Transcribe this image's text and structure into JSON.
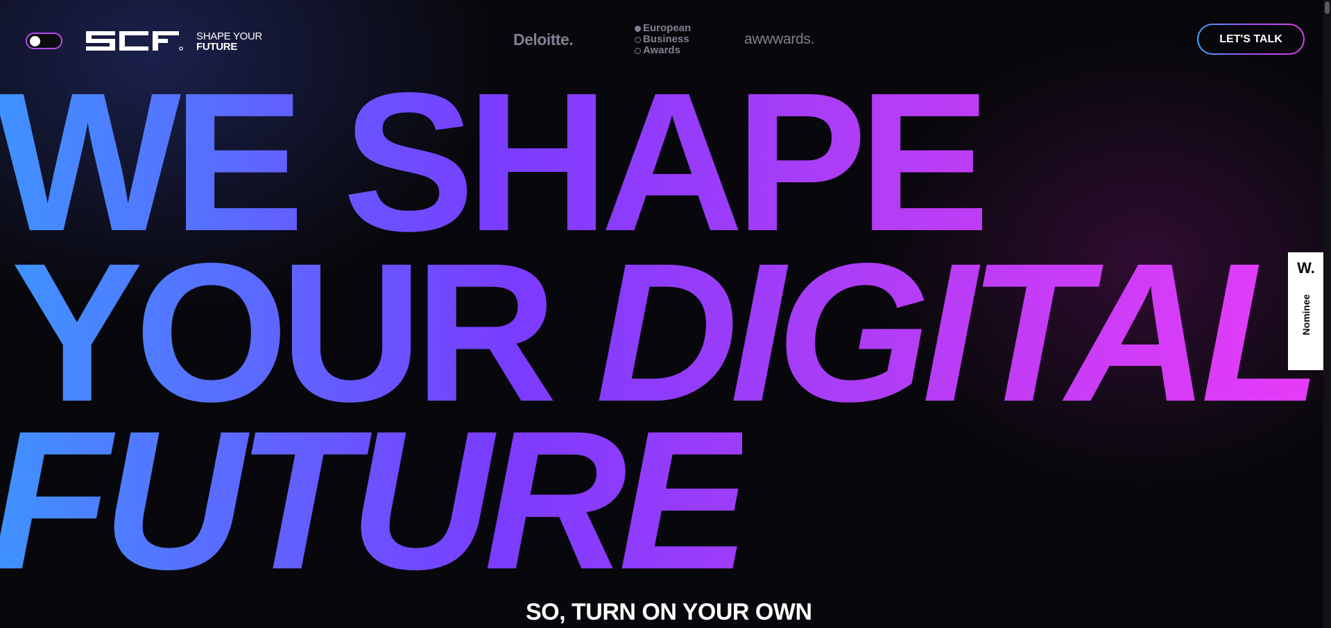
{
  "header": {
    "theme_toggle": "toggle",
    "logo": {
      "alt": "SCF"
    },
    "tagline": {
      "line1": "SHAPE YOUR",
      "line2": "FUTURE"
    },
    "partners": {
      "deloitte": "Deloitte.",
      "european_business_awards": [
        "European",
        "Business",
        "Awards"
      ],
      "awwwards": "awwwards."
    },
    "cta_label": "LET'S TALK"
  },
  "hero": {
    "line1": "WE SHAPE",
    "line2_plain": "YOUR ",
    "line2_italic": "DIGITAL",
    "line3": "FUTURE",
    "subheading": "SO, TURN ON YOUR OWN"
  },
  "badge": {
    "mark": "W.",
    "label": "Nominee"
  },
  "colors": {
    "gradient_start": "#3f93ff",
    "gradient_mid": "#7a3cff",
    "gradient_end": "#ea3bf8",
    "background": "#08080c",
    "partner_gray": "#7f8090"
  }
}
